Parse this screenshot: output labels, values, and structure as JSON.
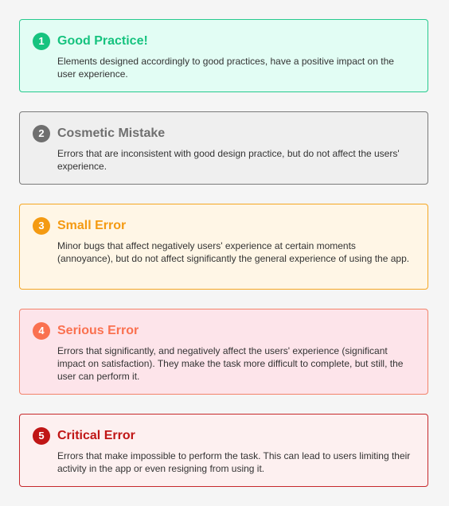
{
  "levels": [
    {
      "number": "1",
      "title": "Good Practice!",
      "description": "Elements designed accordingly to good practices, have a positive impact on the user experience.",
      "color": "#16c37f",
      "background": "#e2fdf4",
      "border": "#27c98d"
    },
    {
      "number": "2",
      "title": "Cosmetic Mistake",
      "description": "Errors that are inconsistent with good design practice, but do not affect the users' experience.",
      "color": "#6f6f6f",
      "background": "#efefef",
      "border": "#7a7a7a"
    },
    {
      "number": "3",
      "title": "Small Error",
      "description": "Minor bugs that affect negatively users' experience at certain moments (annoyance), but do not affect significantly the general experience of using the app.",
      "color": "#f49a12",
      "background": "#fff6e6",
      "border": "#f5a623"
    },
    {
      "number": "4",
      "title": "Serious Error",
      "description": "Errors that significantly, and negatively affect the users' experience (significant impact on satisfaction). They make the task more difficult to complete, but still, the user can perform it.",
      "color": "#fa7150",
      "background": "#fde4ea",
      "border": "#f3826a"
    },
    {
      "number": "5",
      "title": "Critical Error",
      "description": "Errors that make impossible to perform the task. This can lead to users limiting their activity in the app or even resigning from using it.",
      "color": "#c01616",
      "background": "#fdf0f0",
      "border": "#c6282b"
    }
  ]
}
